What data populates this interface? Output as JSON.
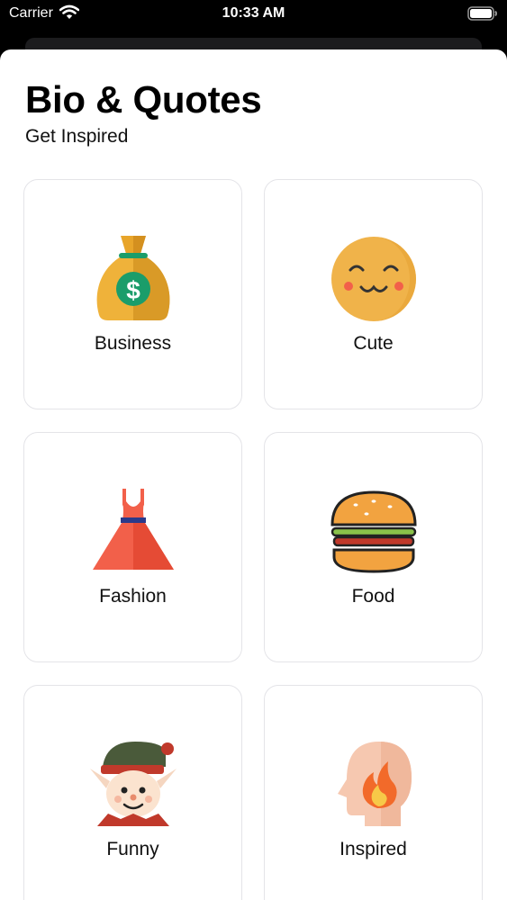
{
  "status_bar": {
    "carrier": "Carrier",
    "time": "10:33 AM",
    "wifi_icon": "wifi-icon",
    "battery_icon": "battery-icon"
  },
  "header": {
    "title": "Bio & Quotes",
    "subtitle": "Get Inspired"
  },
  "categories": [
    {
      "label": "Business",
      "icon": "money-bag-icon"
    },
    {
      "label": "Cute",
      "icon": "smiley-face-icon"
    },
    {
      "label": "Fashion",
      "icon": "dress-icon"
    },
    {
      "label": "Food",
      "icon": "burger-icon"
    },
    {
      "label": "Funny",
      "icon": "elf-icon"
    },
    {
      "label": "Inspired",
      "icon": "head-flame-icon"
    }
  ],
  "colors": {
    "background": "#000000",
    "sheet": "#ffffff",
    "card_border": "#e4e4e8",
    "text": "#111111"
  }
}
